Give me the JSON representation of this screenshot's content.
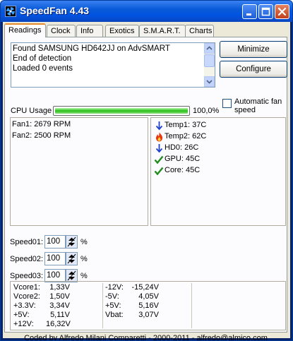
{
  "window": {
    "title": "SpeedFan 4.43"
  },
  "tabs": [
    {
      "label": "Readings"
    },
    {
      "label": "Clock"
    },
    {
      "label": "Info"
    },
    {
      "label": "Exotics"
    },
    {
      "label": "S.M.A.R.T."
    },
    {
      "label": "Charts"
    }
  ],
  "log": {
    "lines": [
      "Found SAMSUNG HD642JJ on AdvSMART",
      "End of detection",
      "Loaded 0 events"
    ]
  },
  "buttons": {
    "minimize": "Minimize",
    "configure": "Configure"
  },
  "auto_fan": {
    "label": "Automatic fan speed",
    "checked": false
  },
  "cpu": {
    "label": "CPU Usage",
    "value": "100,0%",
    "fraction": 1.0,
    "bar_color": "#28c018"
  },
  "fans": [
    {
      "label": "Fan1:",
      "value": "2679 RPM"
    },
    {
      "label": "Fan2:",
      "value": "2500 RPM"
    }
  ],
  "temps": [
    {
      "icon": "arrow-down-icon",
      "label": "Temp1:",
      "value": "37C"
    },
    {
      "icon": "flame-icon",
      "label": "Temp2:",
      "value": "62C"
    },
    {
      "icon": "arrow-down-icon",
      "label": "HD0:",
      "value": "26C"
    },
    {
      "icon": "checkmark-icon",
      "label": "GPU:",
      "value": "45C"
    },
    {
      "icon": "checkmark-icon",
      "label": "Core:",
      "value": "45C"
    }
  ],
  "speeds": [
    {
      "label": "Speed01:",
      "value": "100",
      "unit": "%"
    },
    {
      "label": "Speed02:",
      "value": "100",
      "unit": "%"
    },
    {
      "label": "Speed03:",
      "value": "100",
      "unit": "%"
    }
  ],
  "voltages_left": [
    {
      "label": "Vcore1:",
      "value": "1,33V"
    },
    {
      "label": "Vcore2:",
      "value": "1,50V"
    },
    {
      "label": "+3.3V:",
      "value": "3,34V"
    },
    {
      "label": "+5V:",
      "value": "5,11V"
    },
    {
      "label": "+12V:",
      "value": "16,32V"
    }
  ],
  "voltages_right": [
    {
      "label": "-12V:",
      "value": "-15,24V"
    },
    {
      "label": "-5V:",
      "value": "4,05V"
    },
    {
      "label": "+5V:",
      "value": "5,16V"
    },
    {
      "label": "Vbat:",
      "value": "3,07V"
    }
  ],
  "status": {
    "text": "Coded by Alfredo Milani Comparetti - 2000-2011 - alfredo@almico.com"
  }
}
